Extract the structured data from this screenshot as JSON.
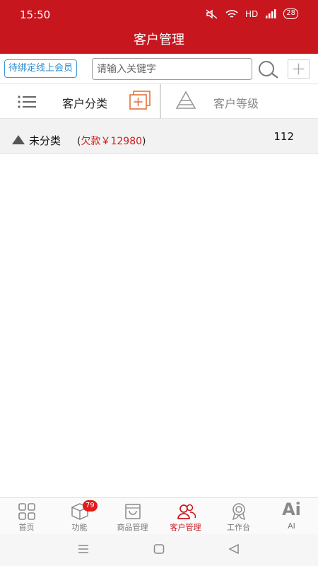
{
  "status": {
    "time": "15:50",
    "network": "HD",
    "battery": "28"
  },
  "header": {
    "title": "客户管理"
  },
  "search": {
    "bind_label": "待绑定线上会员",
    "placeholder": "请输入关键字"
  },
  "tabs": {
    "category_label": "客户分类",
    "level_label": "客户等级"
  },
  "categories": [
    {
      "name": "未分类",
      "owed_prefix": "(",
      "owed_label": "欠款￥12980",
      "owed_suffix": ")",
      "count": "112"
    }
  ],
  "bottom_nav": [
    {
      "label": "首页",
      "icon": "home-grid-icon"
    },
    {
      "label": "功能",
      "icon": "cube-icon",
      "badge": "79"
    },
    {
      "label": "商品管理",
      "icon": "shopping-bag-icon"
    },
    {
      "label": "客户管理",
      "icon": "users-icon",
      "active": true
    },
    {
      "label": "工作台",
      "icon": "award-icon"
    },
    {
      "label": "AI",
      "icon": "ai-icon",
      "glyph": "Ai"
    }
  ],
  "colors": {
    "brand": "#c8161e",
    "link": "#2a8bd0",
    "accent_orange": "#e8703a",
    "debt": "#d21a1a"
  }
}
